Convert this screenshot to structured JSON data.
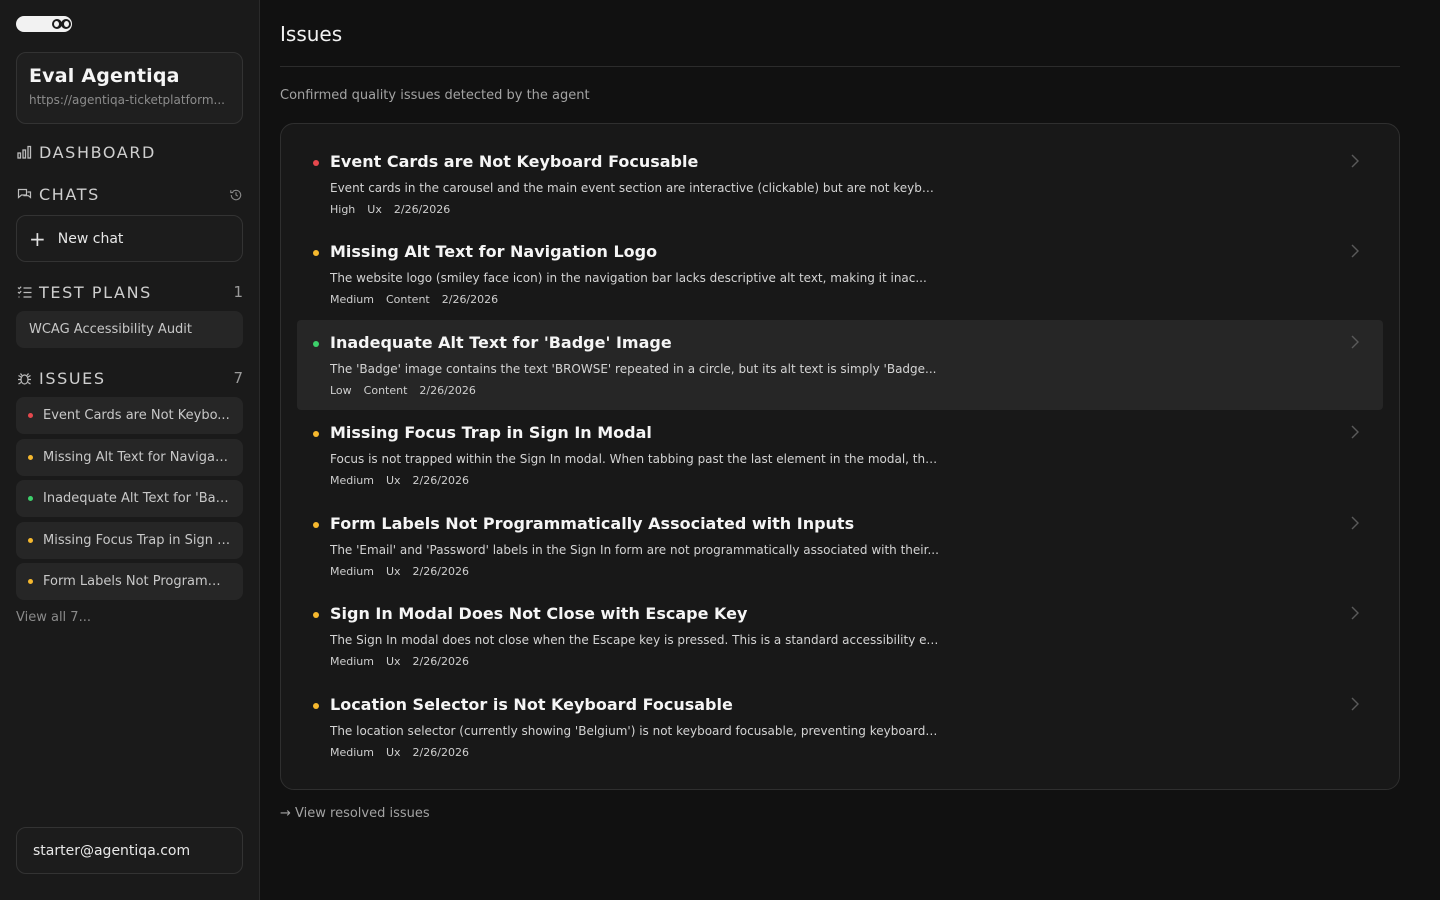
{
  "sidebar": {
    "project": {
      "name": "Eval Agentiqa",
      "url": "https://agentiqa-ticketplatform..."
    },
    "dashboard_label": "DASHBOARD",
    "chats_label": "CHATS",
    "new_chat_label": "New chat",
    "test_plans": {
      "label": "TEST PLANS",
      "count": "1",
      "items": [
        "WCAG Accessibility Audit"
      ]
    },
    "issues": {
      "label": "ISSUES",
      "count": "7",
      "items": [
        {
          "label": "Event Cards are Not Keybo...",
          "severity_color": "#e5484d"
        },
        {
          "label": "Missing Alt Text for Navigati...",
          "severity_color": "#f5b82e"
        },
        {
          "label": "Inadequate Alt Text for 'Bad...",
          "severity_color": "#3dd06b"
        },
        {
          "label": "Missing Focus Trap in Sign I...",
          "severity_color": "#f5b82e"
        },
        {
          "label": "Form Labels Not Programm...",
          "severity_color": "#f5b82e"
        }
      ],
      "view_all": "View all 7..."
    },
    "user_email": "starter@agentiqa.com"
  },
  "main": {
    "title": "Issues",
    "subtitle": "Confirmed quality issues detected by the agent",
    "issues": [
      {
        "title": "Event Cards are Not Keyboard Focusable",
        "description": "Event cards in the carousel and the main event section are interactive (clickable) but are not keybo...",
        "severity": "High",
        "category": "Ux",
        "date": "2/26/2026",
        "severity_color": "#e5484d"
      },
      {
        "title": "Missing Alt Text for Navigation Logo",
        "description": "The website logo (smiley face icon) in the navigation bar lacks descriptive alt text, making it inac...",
        "severity": "Medium",
        "category": "Content",
        "date": "2/26/2026",
        "severity_color": "#f5b82e"
      },
      {
        "title": "Inadequate Alt Text for 'Badge' Image",
        "description": "The 'Badge' image contains the text 'BROWSE' repeated in a circle, but its alt text is simply 'Badge...",
        "severity": "Low",
        "category": "Content",
        "date": "2/26/2026",
        "severity_color": "#3dd06b"
      },
      {
        "title": "Missing Focus Trap in Sign In Modal",
        "description": "Focus is not trapped within the Sign In modal. When tabbing past the last element in the modal, the ...",
        "severity": "Medium",
        "category": "Ux",
        "date": "2/26/2026",
        "severity_color": "#f5b82e"
      },
      {
        "title": "Form Labels Not Programmatically Associated with Inputs",
        "description": "The 'Email' and 'Password' labels in the Sign In form are not programmatically associated with their...",
        "severity": "Medium",
        "category": "Ux",
        "date": "2/26/2026",
        "severity_color": "#f5b82e"
      },
      {
        "title": "Sign In Modal Does Not Close with Escape Key",
        "description": "The Sign In modal does not close when the Escape key is pressed. This is a standard accessibility ex...",
        "severity": "Medium",
        "category": "Ux",
        "date": "2/26/2026",
        "severity_color": "#f5b82e"
      },
      {
        "title": "Location Selector is Not Keyboard Focusable",
        "description": "The location selector (currently showing 'Belgium') is not keyboard focusable, preventing keyboard u...",
        "severity": "Medium",
        "category": "Ux",
        "date": "2/26/2026",
        "severity_color": "#f5b82e"
      }
    ],
    "resolved_link": "→ View resolved issues"
  }
}
